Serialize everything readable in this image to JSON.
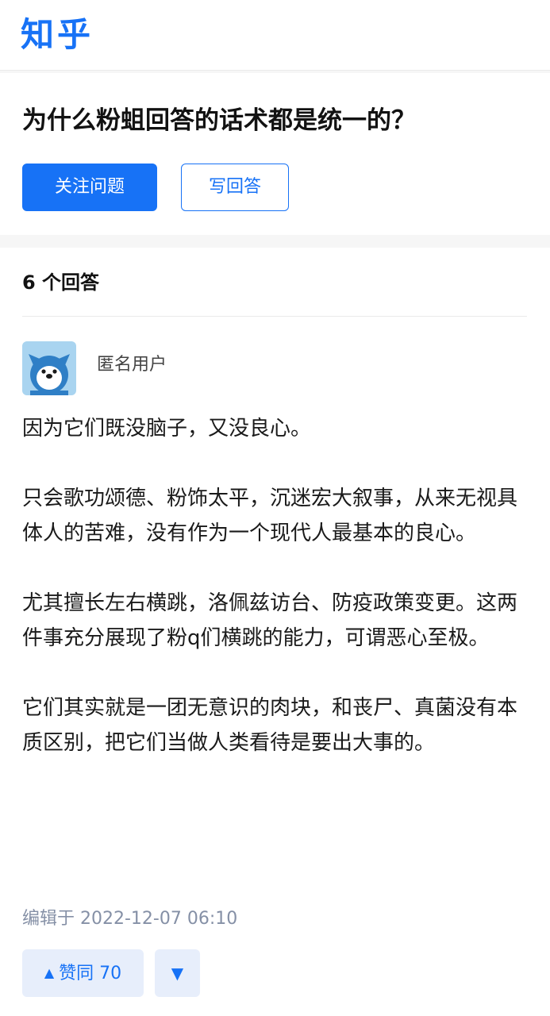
{
  "header": {
    "logo": "知乎"
  },
  "question": {
    "title": "为什么粉蛆回答的话术都是统一的？",
    "follow_label": "关注问题",
    "write_answer_label": "写回答"
  },
  "answers": {
    "count_label": "6 个回答",
    "items": [
      {
        "author": "匿名用户",
        "avatar_icon": "anonymous-avatar-icon",
        "paragraphs": [
          "因为它们既没脑子，又没良心。",
          "只会歌功颂德、粉饰太平，沉迷宏大叙事，从来无视具体人的苦难，没有作为一个现代人最基本的良心。",
          "尤其擅长左右横跳，洛佩兹访台、防疫政策变更。这两件事充分展现了粉q们横跳的能力，可谓恶心至极。",
          "它们其实就是一团无意识的肉块，和丧尸、真菌没有本质区别，把它们当做人类看待是要出大事的。"
        ],
        "edit_time": "编辑于 2022-12-07 06:10",
        "upvote_label": "赞同 70",
        "upvote_icon": "triangle-up-icon",
        "downvote_icon": "triangle-down-icon"
      }
    ]
  },
  "colors": {
    "brand": "#1772f6",
    "vote_bg": "#e7eefb",
    "meta_text": "#8590a6"
  }
}
